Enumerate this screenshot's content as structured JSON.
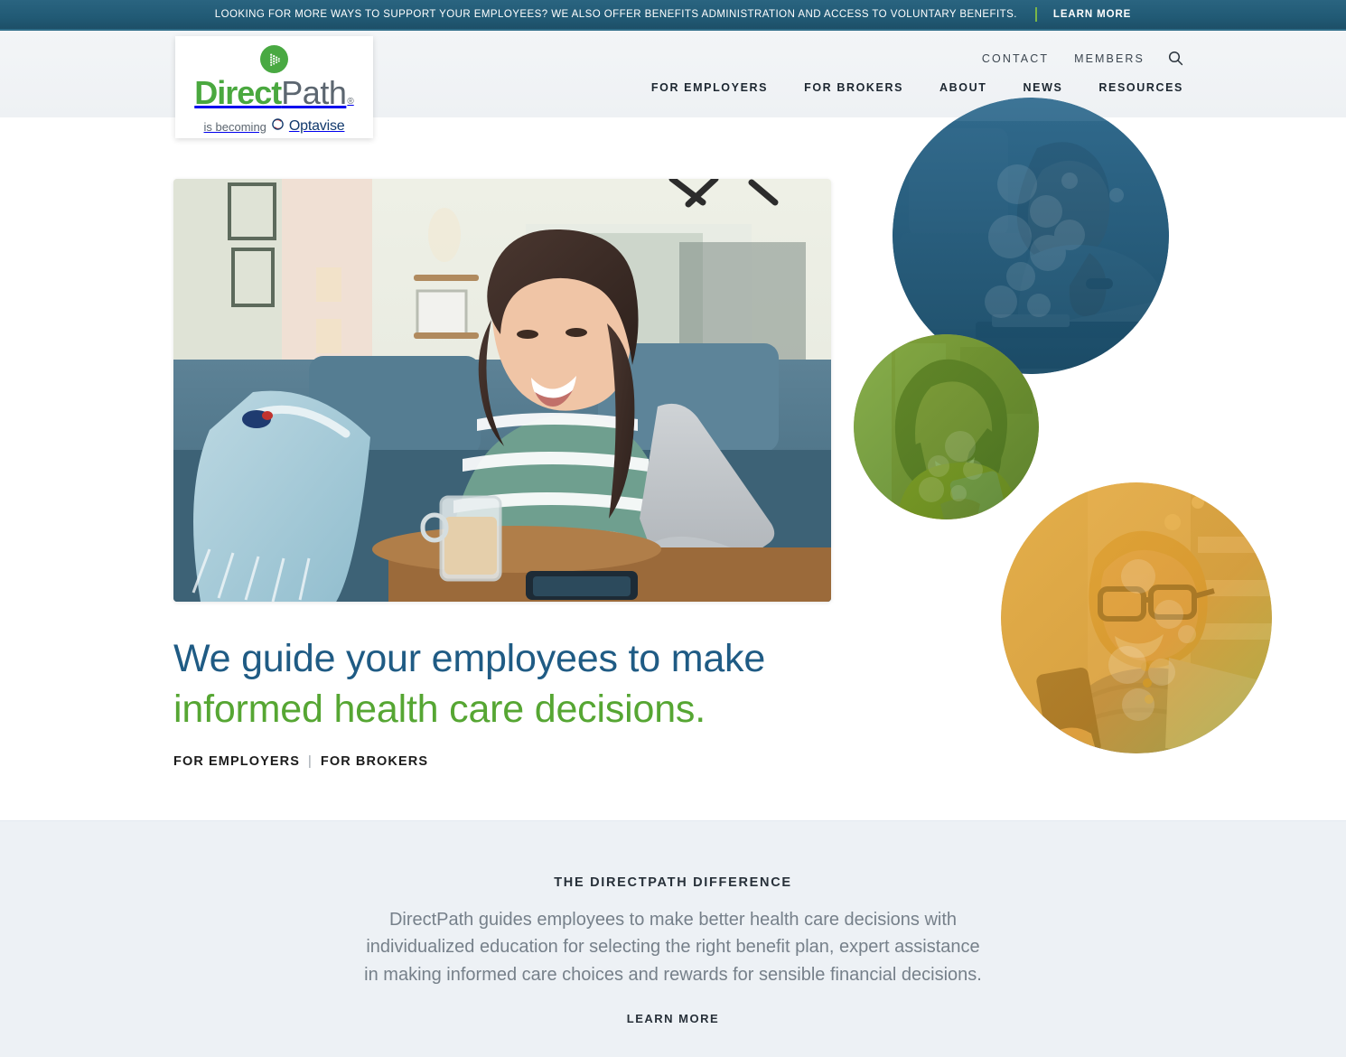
{
  "promo": {
    "text": "LOOKING FOR MORE WAYS TO SUPPORT YOUR EMPLOYEES? WE ALSO OFFER BENEFITS ADMINISTRATION AND ACCESS TO VOLUNTARY BENEFITS.",
    "cta": "LEARN MORE",
    "bg_color": "#235d78",
    "divider_color": "#7ab648"
  },
  "header": {
    "utility_nav": [
      {
        "label": "CONTACT"
      },
      {
        "label": "MEMBERS"
      }
    ],
    "search_icon": "search-icon",
    "main_nav": [
      {
        "label": "FOR EMPLOYERS"
      },
      {
        "label": "FOR BROKERS"
      },
      {
        "label": "ABOUT"
      },
      {
        "label": "NEWS"
      },
      {
        "label": "RESOURCES"
      }
    ],
    "bg_color": "#eef1f4"
  },
  "logo": {
    "mark_icon": "chevron-arrow-circle-icon",
    "name_primary": "Direct",
    "name_secondary": "Path",
    "registered": "®",
    "tagline": "is becoming",
    "partner_icon": "optavise-swirl-icon",
    "partner_name": "Optavise",
    "green": "#4aa83f",
    "gray": "#5c6670",
    "navy": "#123a6d"
  },
  "hero": {
    "photo_alt": "woman-on-couch-with-laptop",
    "headline_line1": "We guide your employees to make",
    "headline_line2": "informed health care decisions.",
    "headline_color_1": "#1f5b84",
    "headline_color_2": "#56a633",
    "links": [
      {
        "label": "FOR EMPLOYERS"
      },
      {
        "label": "FOR BROKERS"
      }
    ],
    "link_separator": "|",
    "circles": [
      {
        "name": "circle-photo-man-laptop",
        "tint": "#1f5a7d"
      },
      {
        "name": "circle-photo-woman-phone",
        "tint": "#6aa230"
      },
      {
        "name": "circle-photo-woman-glasses-phone",
        "tint": "#e8a13a"
      }
    ]
  },
  "difference": {
    "kicker": "THE DIRECTPATH DIFFERENCE",
    "body": "DirectPath guides employees to make better health care decisions with individualized education for selecting the right benefit plan, expert assistance in making informed care choices and rewards for sensible financial decisions.",
    "cta": "LEARN MORE",
    "bg_color": "#edf1f5"
  }
}
